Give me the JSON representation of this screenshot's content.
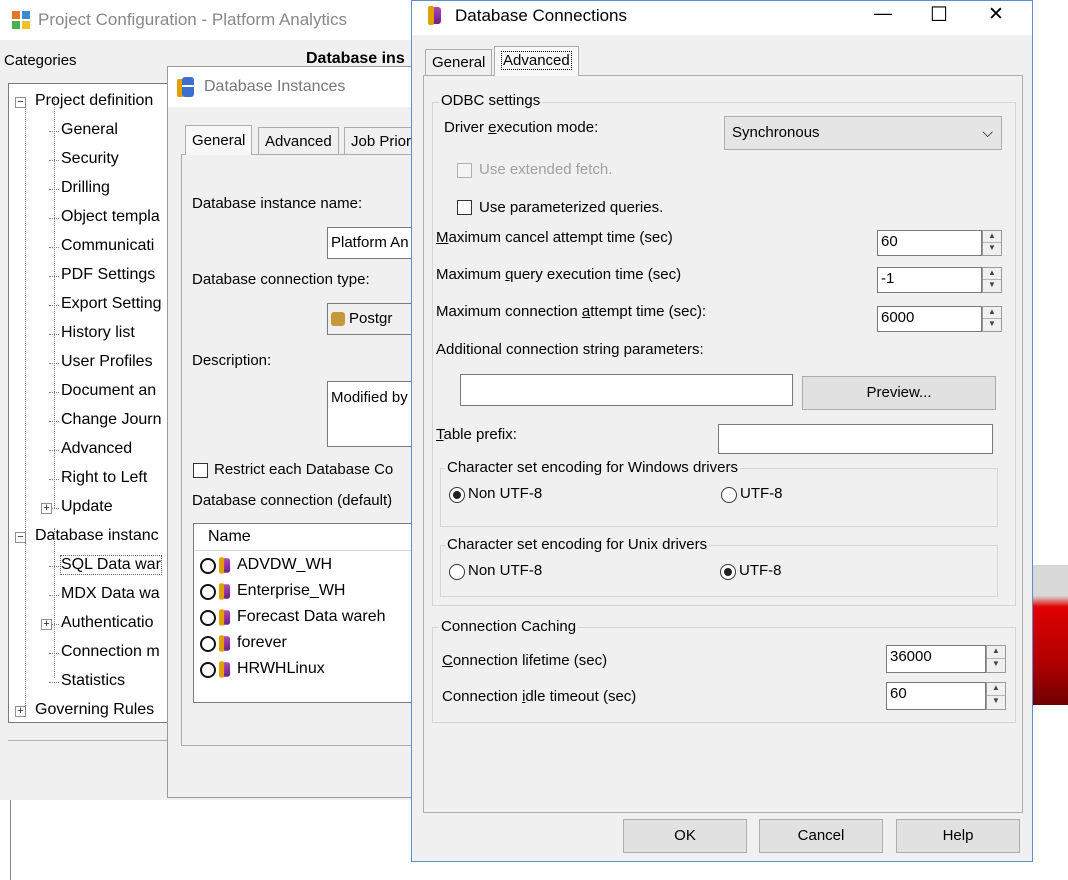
{
  "project_window": {
    "title": "Project Configuration - Platform Analytics",
    "categories_label": "Categories",
    "header_partial": "Database ins",
    "tree": [
      {
        "label": "Project definition",
        "level": 0,
        "expander": "−"
      },
      {
        "label": "General",
        "level": 1
      },
      {
        "label": "Security",
        "level": 1
      },
      {
        "label": "Drilling",
        "level": 1
      },
      {
        "label": "Object templa",
        "level": 1
      },
      {
        "label": "Communicati",
        "level": 1
      },
      {
        "label": "PDF Settings",
        "level": 1
      },
      {
        "label": "Export Setting",
        "level": 1
      },
      {
        "label": "History list",
        "level": 1
      },
      {
        "label": "User Profiles",
        "level": 1
      },
      {
        "label": "Document an",
        "level": 1
      },
      {
        "label": "Change Journ",
        "level": 1
      },
      {
        "label": "Advanced",
        "level": 1
      },
      {
        "label": "Right to Left",
        "level": 1
      },
      {
        "label": "Update",
        "level": 1,
        "expander": "+"
      },
      {
        "label": "Database instanc",
        "level": 0,
        "expander": "−"
      },
      {
        "label": "SQL Data war",
        "level": 1,
        "selected": true
      },
      {
        "label": "MDX Data wa",
        "level": 1
      },
      {
        "label": "Authenticatio",
        "level": 1,
        "expander": "+"
      },
      {
        "label": "Connection m",
        "level": 1
      },
      {
        "label": "Statistics",
        "level": 1
      },
      {
        "label": "Governing Rules",
        "level": 0,
        "expander": "+"
      }
    ]
  },
  "db_instances_window": {
    "title": "Database Instances",
    "tabs": [
      "General",
      "Advanced",
      "Job Prior"
    ],
    "instance_name_label": "Database instance name:",
    "instance_name_value": "Platform An",
    "connection_type_label": "Database connection type:",
    "connection_type_value": "Postgr",
    "description_label": "Description:",
    "description_value": "Modified by",
    "restrict_label": "Restrict each Database Co",
    "default_connection_label": "Database connection (default)",
    "list_header": "Name",
    "connections": [
      "ADVDW_WH",
      "Enterprise_WH",
      "Forecast Data wareh",
      "forever",
      "HRWHLinux"
    ]
  },
  "db_connections_dialog": {
    "title": "Database Connections",
    "controls": {
      "minimize": "—",
      "maximize": "☐",
      "close": "✕"
    },
    "tabs": [
      "General",
      "Advanced"
    ],
    "odbc_group": "ODBC settings",
    "driver_mode_label": "Driver execution mode:",
    "driver_mode_value": "Synchronous",
    "extended_fetch_label": "Use extended fetch.",
    "parameterized_label": "Use parameterized queries.",
    "cancel_time_label": "Maximum cancel attempt time (sec)",
    "cancel_time_value": "60",
    "query_time_label": "Maximum query execution time (sec)",
    "query_time_value": "-1",
    "connection_time_label": "Maximum connection attempt time (sec):",
    "connection_time_value": "6000",
    "additional_params_label": "Additional connection string parameters:",
    "additional_params_value": "",
    "preview_button": "Preview...",
    "table_prefix_label": "Table prefix:",
    "table_prefix_value": "",
    "win_encoding_group": "Character set encoding for Windows drivers",
    "win_non_utf8": "Non UTF-8",
    "win_utf8": "UTF-8",
    "unix_encoding_group": "Character set encoding for Unix drivers",
    "unix_non_utf8": "Non UTF-8",
    "unix_utf8": "UTF-8",
    "caching_group": "Connection Caching",
    "lifetime_label": "Connection lifetime (sec)",
    "lifetime_value": "36000",
    "idle_label": "Connection idle timeout (sec)",
    "idle_value": "60",
    "ok_button": "OK",
    "cancel_button": "Cancel",
    "help_button": "Help"
  }
}
